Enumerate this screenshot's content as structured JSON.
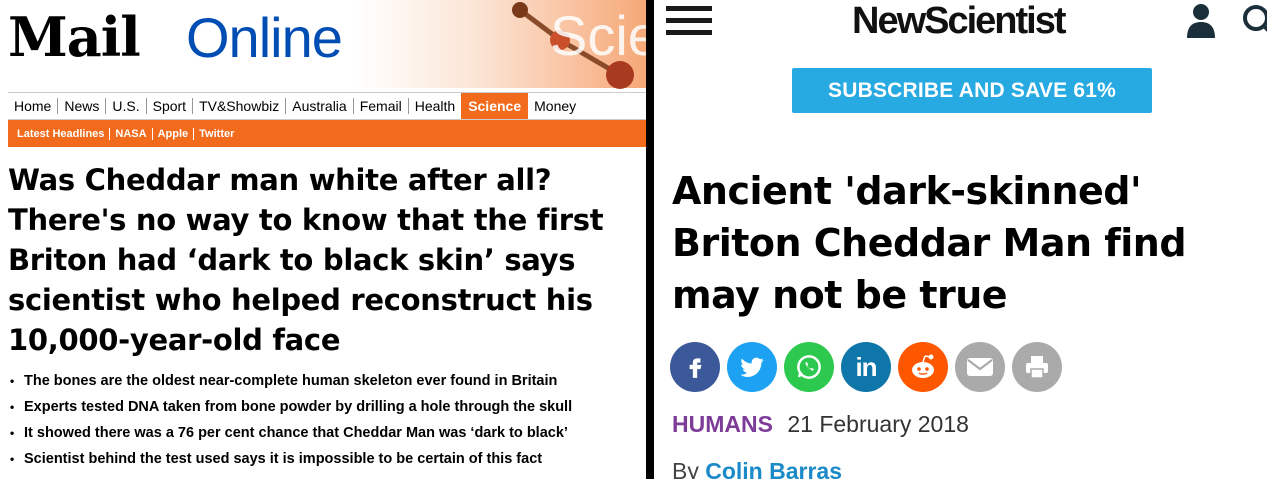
{
  "mail": {
    "logo_main": "Mail",
    "logo_online": "Online",
    "section_banner": "Scie",
    "nav": [
      "Home",
      "News",
      "U.S.",
      "Sport",
      "TV&Showbiz",
      "Australia",
      "Femail",
      "Health",
      "Science",
      "Money"
    ],
    "nav_active": "Science",
    "subnav": [
      "Latest Headlines",
      "NASA",
      "Apple",
      "Twitter"
    ],
    "headline": "Was Cheddar man white after all? There's no way to know that the first Briton had ‘dark to black skin’ says scientist who helped reconstruct his 10,000-year-old face",
    "bullets": [
      "The bones are the oldest near-complete human skeleton ever found in Britain",
      "Experts tested DNA taken from bone powder by drilling a hole through the skull",
      "It showed there was a 76 per cent chance that Cheddar Man was ‘dark to black’",
      "Scientist behind the test used says  it is impossible to be certain of this fact"
    ],
    "colors": {
      "accent": "#f26a1c",
      "online_blue": "#004db3"
    }
  },
  "ns": {
    "logo": "NewScientist",
    "subscribe_label": "SUBSCRIBE AND SAVE 61%",
    "title": "Ancient 'dark-skinned' Briton Cheddar Man find may not be true",
    "share_icons": [
      "facebook-icon",
      "twitter-icon",
      "whatsapp-icon",
      "linkedin-icon",
      "reddit-icon",
      "email-icon",
      "print-icon"
    ],
    "category": "HUMANS",
    "date": "21 February 2018",
    "byline_prefix": "By",
    "author": "Colin Barras",
    "colors": {
      "subscribe": "#27a9e1",
      "category": "#7d3c98",
      "author": "#1a8ac8"
    }
  }
}
